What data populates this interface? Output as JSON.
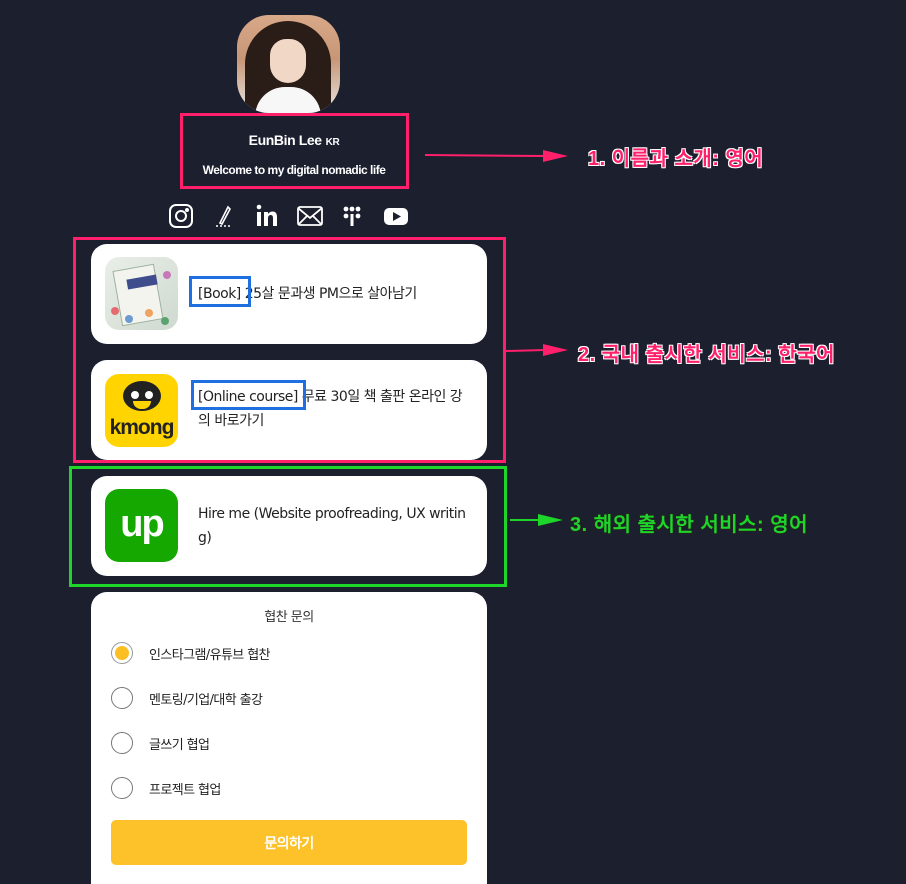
{
  "profile": {
    "name": "EunBin Lee",
    "country": "KR",
    "intro": "Welcome to my digital nomadic life"
  },
  "social_icons": [
    "instagram-icon",
    "pen-icon",
    "linkedin-icon",
    "mail-icon",
    "linktree-icon",
    "youtube-icon"
  ],
  "links": [
    {
      "tag": "[Book]",
      "text": " 25살 문과생 PM으로 살아남기"
    },
    {
      "tag": "[Online course]",
      "text": " 무료 30일 책 출판 온라인 강의 바로가기"
    },
    {
      "tag": "",
      "text": "Hire me (Website proofreading, UX writing)"
    }
  ],
  "logos": {
    "kmong": "kmong",
    "upwork": "up"
  },
  "form": {
    "title": "협찬 문의",
    "options": [
      "인스타그램/유튜브 협찬",
      "멘토링/기업/대학 출강",
      "글쓰기 협업",
      "프로젝트 협업"
    ],
    "selected_index": 0,
    "submit_label": "문의하기"
  },
  "annotations": [
    "1. 이름과 소개: 영어",
    "2. 국내 출시한 서비스: 한국어",
    "3. 해외 출시한 서비스: 영어"
  ],
  "colors": {
    "background": "#1b1f2e",
    "annotation_red": "#ff1f6a",
    "annotation_green": "#1ed52a",
    "highlight_blue": "#1e6fe0",
    "submit_button": "#fdc12a",
    "radio_selected": "#fbbf24"
  }
}
